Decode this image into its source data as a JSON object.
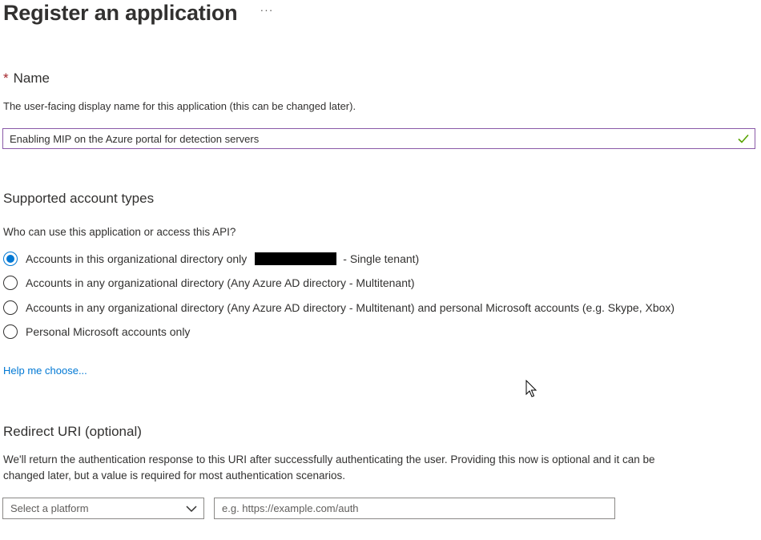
{
  "header": {
    "title": "Register an application",
    "more_label": "···"
  },
  "name_section": {
    "required_marker": "*",
    "heading": "Name",
    "description": "The user-facing display name for this application (this can be changed later).",
    "input_value": "Enabling MIP on the Azure portal for detection servers",
    "valid_icon": "checkmark-icon"
  },
  "account_types": {
    "heading": "Supported account types",
    "question": "Who can use this application or access this API?",
    "options": [
      {
        "label_before": "Accounts in this organizational directory only",
        "label_after": "- Single tenant)",
        "selected": true,
        "redacted": true
      },
      {
        "label": "Accounts in any organizational directory (Any Azure AD directory - Multitenant)",
        "selected": false
      },
      {
        "label": "Accounts in any organizational directory (Any Azure AD directory - Multitenant) and personal Microsoft accounts (e.g. Skype, Xbox)",
        "selected": false
      },
      {
        "label": "Personal Microsoft accounts only",
        "selected": false
      }
    ],
    "help_link": "Help me choose..."
  },
  "redirect": {
    "heading": "Redirect URI (optional)",
    "description_line1": "We'll return the authentication response to this URI after successfully authenticating the user. Providing this now is optional and it can be",
    "description_line2": "changed later, but a value is required for most authentication scenarios.",
    "platform_placeholder": "Select a platform",
    "uri_placeholder": "e.g. https://example.com/auth"
  },
  "colors": {
    "accent": "#0078d4",
    "required": "#a4262c",
    "valid": "#57a300",
    "focus_border": "#8a5aa8"
  }
}
